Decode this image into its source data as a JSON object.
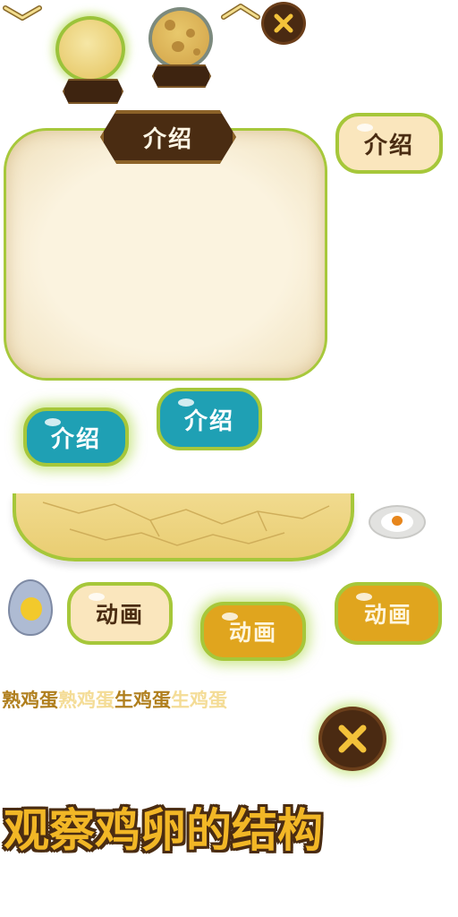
{
  "buttons": {
    "intro_label": "介绍",
    "animation_label": "动画"
  },
  "panel": {
    "title": "介绍"
  },
  "egg_labels": {
    "cooked_egg": "熟鸡蛋",
    "cooked_egg_dim": "熟鸡蛋",
    "raw_egg": "生鸡蛋",
    "raw_egg_dim": "生鸡蛋"
  },
  "title": "观察鸡卵的结构",
  "icons": {
    "close": "close-icon",
    "chevron_down": "chevron-down-icon",
    "chevron_up": "chevron-up-icon"
  },
  "colors": {
    "green_border": "#a6c73a",
    "dark_brown": "#4a2c12",
    "cream": "#fae6bd",
    "teal": "#1fa0b4",
    "gold": "#e0a51e",
    "title_yellow": "#f2b726",
    "label_brown": "#b07f1e",
    "label_light": "#f4dc96"
  }
}
